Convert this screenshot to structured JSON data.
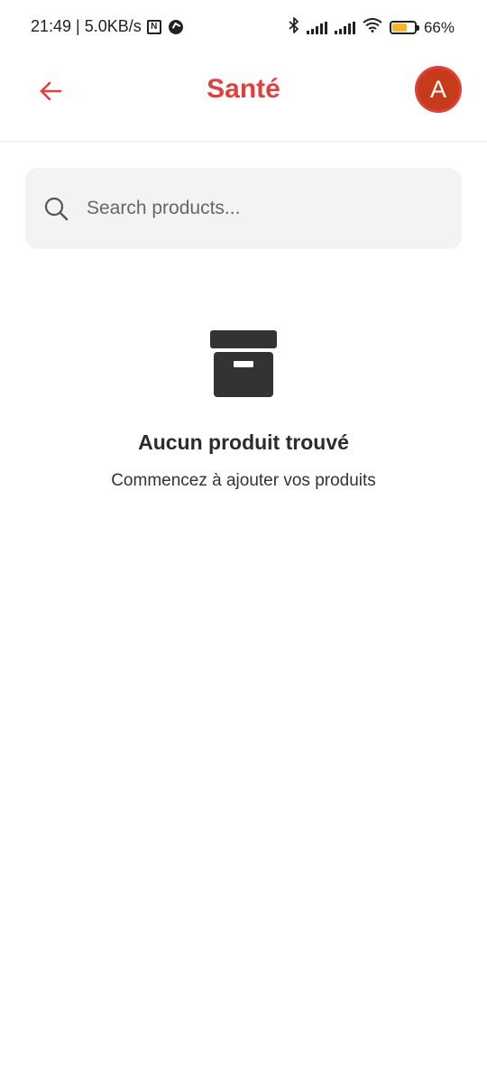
{
  "status_bar": {
    "time_speed": "21:49 | 5.0KB/s",
    "nfc_label": "N",
    "battery_percent_text": "66%",
    "battery_level": 0.66,
    "battery_color": "#f5b729"
  },
  "header": {
    "title": "Santé",
    "back_icon": "arrow-left-icon",
    "avatar_initial": "A",
    "accent_color": "#e0403e"
  },
  "search": {
    "placeholder": "Search products...",
    "value": "",
    "icon": "search-icon"
  },
  "empty_state": {
    "icon": "archive-box-icon",
    "title": "Aucun produit trouvé",
    "subtitle": "Commencez à ajouter vos produits"
  }
}
